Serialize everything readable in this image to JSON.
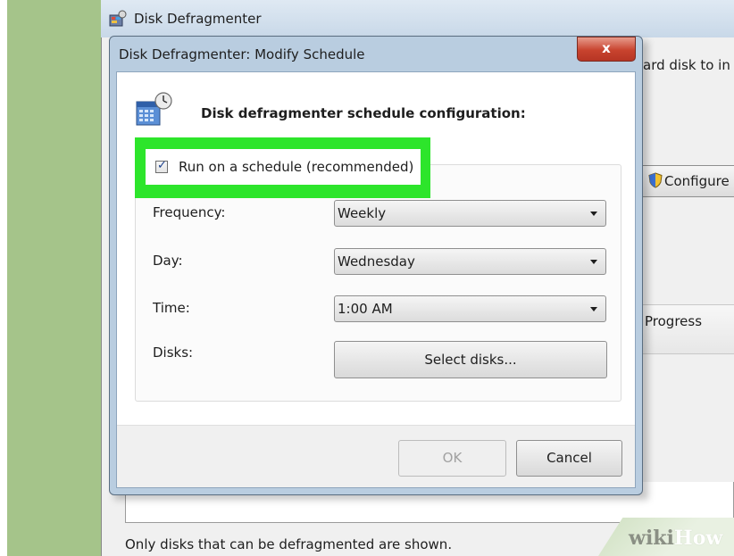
{
  "parent_window": {
    "title": "Disk Defragmenter",
    "description_fragment": "ard disk to in",
    "configure_button_label": "Configure s",
    "column_header_progress": "Progress",
    "footer_text": "Only disks that can be defragmented are shown."
  },
  "dialog": {
    "title": "Disk Defragmenter: Modify Schedule",
    "close_glyph": "x",
    "heading": "Disk defragmenter schedule configuration:",
    "schedule_checkbox": {
      "label": "Run on a schedule (recommended)",
      "checked": true
    },
    "frequency": {
      "label": "Frequency:",
      "value": "Weekly"
    },
    "day": {
      "label": "Day:",
      "value": "Wednesday"
    },
    "time": {
      "label": "Time:",
      "value": "1:00 AM"
    },
    "disks": {
      "label": "Disks:",
      "button_label": "Select disks..."
    },
    "ok_label": "OK",
    "cancel_label": "Cancel"
  },
  "watermark": {
    "wiki": "wiki",
    "how": "How"
  },
  "colors": {
    "highlight": "#2de52b",
    "close_button": "#c8432e",
    "dialog_frame": "#b9cde0"
  },
  "icons": [
    "defragmenter-app-icon",
    "schedule-icon",
    "close-icon",
    "checkmark-icon",
    "chevron-down-icon",
    "shield-icon"
  ]
}
